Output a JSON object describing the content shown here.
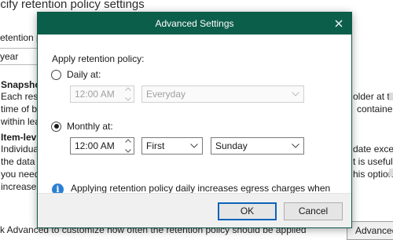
{
  "background": {
    "heading": "ecify retention policy settings",
    "retention_label": "etention po",
    "retention_value": "year",
    "snapshot_title": "Snapshot",
    "snapshot_line1": "Each rest",
    "snapshot_line2": "time of b",
    "snapshot_line3": "within lea",
    "snapshot_right1": "older at the",
    "snapshot_right2": "containe",
    "item_title": "Item-lev",
    "item_line1": "Individua",
    "item_line2": "the data",
    "item_line3": "you need",
    "item_line4": "increases",
    "item_right1": "date excee",
    "item_right2": "t is useful i",
    "item_right3": "his option",
    "hint": "ck Advanced to customize how often the retention policy should be applied",
    "advanced_button": "Advanced"
  },
  "dialog": {
    "title": "Advanced Settings",
    "section_label": "Apply retention policy:",
    "daily": {
      "label": "Daily at:",
      "selected": false,
      "time": "12:00 AM",
      "day": "Everyday"
    },
    "monthly": {
      "label": "Monthly at:",
      "selected": true,
      "time": "12:00 AM",
      "week": "First",
      "weekday": "Sunday"
    },
    "info_text": "Applying retention policy daily increases egress charges when using object storage repository.",
    "ok_label": "OK",
    "cancel_label": "Cancel"
  },
  "colors": {
    "titlebar": "#0b5e4a",
    "info_icon": "#2b7fd3",
    "default_button_border": "#0b63b8"
  }
}
